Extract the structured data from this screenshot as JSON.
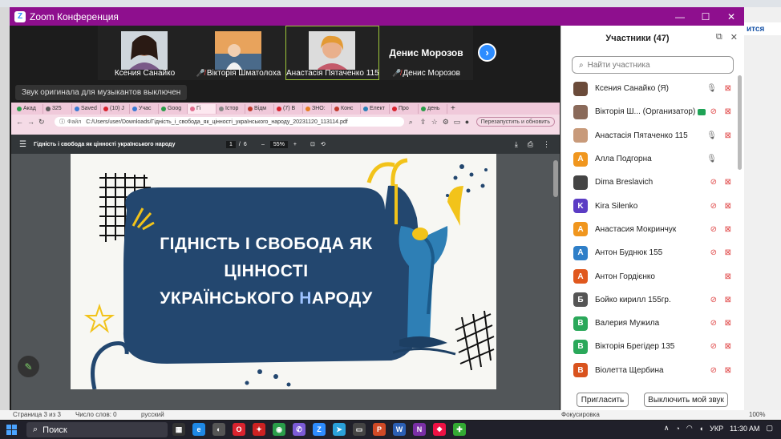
{
  "window": {
    "title": "Zoom Конференция"
  },
  "gallery": {
    "tiles": [
      {
        "name": "Ксения Санайко",
        "muted": false,
        "active": false
      },
      {
        "name": "Вікторія Шматолоха",
        "muted": true,
        "active": false
      },
      {
        "name": "Анастасія Пятаченко 115",
        "muted": false,
        "active": true
      },
      {
        "name": "Денис Морозов",
        "muted": true,
        "active": false,
        "bigname": "Денис Морозов"
      }
    ]
  },
  "tooltip": "Звук оригинала для музыкантов выключен",
  "browser": {
    "tabs": [
      "Акад",
      "325",
      "Saved",
      "(10) J",
      "Учас",
      "Goog",
      "Гі",
      "Істор",
      "Відм",
      "(7) B",
      "ЗНО:",
      "Конс",
      "Елект",
      "Про",
      "день"
    ],
    "active_tab_index": 6,
    "address_prefix": "Файл",
    "address": "C:/Users/user/Downloads/Гідність_і_свобода_як_цінності_українського_народу_20231120_113114.pdf",
    "update_button": "Перезапустить и обновить"
  },
  "pdf": {
    "title": "Гідність і свобода як цінності українського народу",
    "page_current": "1",
    "page_sep": "/",
    "page_total": "6",
    "zoom": "55%",
    "zoom_minus": "–",
    "zoom_plus": "+"
  },
  "slide": {
    "line1": "ГІДНІСТЬ І СВОБОДА ЯК",
    "line2": "ЦІННОСТІ",
    "line3_a": "УКРАЇНСЬКОГО ",
    "line3_b": "Н",
    "line3_c": "АРОДУ"
  },
  "panel": {
    "title": "Участники (47)",
    "search_placeholder": "Найти участника",
    "invite": "Пригласить",
    "mute_me": "Выключить мой звук"
  },
  "participants": [
    {
      "name": "Ксения Санайко (Я)",
      "avatar": "",
      "color": "#6b4b3a",
      "mic": "on",
      "video": "off"
    },
    {
      "name": "Вікторія Ш... (Организатор)",
      "avatar": "",
      "color": "#8a6a5a",
      "mic": "off",
      "video": "off",
      "host": true
    },
    {
      "name": "Анастасія Пятаченко 115",
      "avatar": "",
      "color": "#c89a7a",
      "mic": "on",
      "video": "off"
    },
    {
      "name": "Алла Подгорна",
      "avatar": "А",
      "color": "#f0961e",
      "mic": "on",
      "video": "none"
    },
    {
      "name": "Dima Breslavich",
      "avatar": "",
      "color": "#444",
      "mic": "off",
      "video": "off"
    },
    {
      "name": "Kira Silenko",
      "avatar": "K",
      "color": "#5b3cc4",
      "mic": "off",
      "video": "off"
    },
    {
      "name": "Анастасия Мокринчук",
      "avatar": "А",
      "color": "#f0961e",
      "mic": "off",
      "video": "off"
    },
    {
      "name": "Антон Буднюк 155",
      "avatar": "А",
      "color": "#2f7fc8",
      "mic": "off",
      "video": "off"
    },
    {
      "name": "Антон Гордієнко",
      "avatar": "А",
      "color": "#e0581e",
      "mic": "none",
      "video": "off"
    },
    {
      "name": "Бойко кирилл 155гр.",
      "avatar": "Б",
      "color": "#555",
      "mic": "off",
      "video": "off"
    },
    {
      "name": "Валерия Мужила",
      "avatar": "В",
      "color": "#2aa85a",
      "mic": "off",
      "video": "off"
    },
    {
      "name": "Вікторія Брегідер 135",
      "avatar": "В",
      "color": "#2aa85a",
      "mic": "off",
      "video": "off"
    },
    {
      "name": "Віолетта Щербина",
      "avatar": "В",
      "color": "#d9531e",
      "mic": "off",
      "video": "off"
    }
  ],
  "background": {
    "link_fragment": "ится",
    "status_left": "Страница 3 из 3",
    "status_words": "Число слов: 0",
    "status_lang": "русский",
    "status_focus": "Фокусировка",
    "status_zoom": "100%"
  },
  "taskbar": {
    "search": "Поиск",
    "lang": "УКР",
    "time": "11:30 AM"
  }
}
